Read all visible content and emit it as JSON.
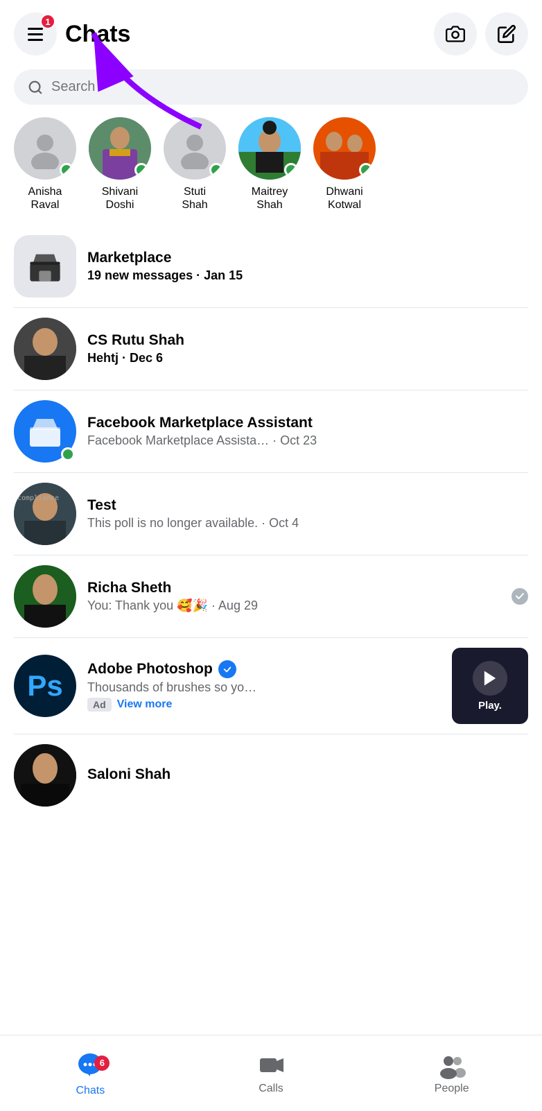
{
  "header": {
    "title": "Chats",
    "badge": "1",
    "camera_label": "camera",
    "compose_label": "compose"
  },
  "search": {
    "placeholder": "Search"
  },
  "stories": [
    {
      "id": "anisha",
      "name": "Anisha\nRaval",
      "online": true,
      "has_photo": false
    },
    {
      "id": "shivani",
      "name": "Shivani\nDoshi",
      "online": true,
      "has_photo": true
    },
    {
      "id": "stuti",
      "name": "Stuti\nShah",
      "online": true,
      "has_photo": false
    },
    {
      "id": "maitrey",
      "name": "Maitrey\nShah",
      "online": true,
      "has_photo": true
    },
    {
      "id": "dhwani",
      "name": "Dhwani\nKotwal",
      "online": true,
      "has_photo": true
    }
  ],
  "chats": [
    {
      "id": "marketplace",
      "name": "Marketplace",
      "preview": "19 new messages",
      "date": "Jan 15",
      "type": "marketplace",
      "bold": true
    },
    {
      "id": "cs-rutu-shah",
      "name": "CS Rutu Shah",
      "preview": "Hehtj",
      "date": "Dec 6",
      "type": "person",
      "bold": true
    },
    {
      "id": "fb-marketplace-assistant",
      "name": "Facebook Marketplace Assistant",
      "preview": "Facebook Marketplace Assista…",
      "date": "Oct 23",
      "type": "fb-marketplace",
      "online": true,
      "bold": false
    },
    {
      "id": "test",
      "name": "Test",
      "preview": "This poll is no longer available.",
      "date": "Oct 4",
      "type": "person",
      "bold": false
    },
    {
      "id": "richa-sheth",
      "name": "Richa Sheth",
      "preview": "You: Thank you 🥰🎉",
      "date": "Aug 29",
      "type": "person",
      "bold": false,
      "read": true
    },
    {
      "id": "adobe-photoshop",
      "name": "Adobe Photoshop",
      "preview": "Thousands of brushes so yo…",
      "date": "",
      "type": "ad",
      "verified": true,
      "bold": false,
      "ad_label": "Ad",
      "view_more": "View more"
    },
    {
      "id": "saloni-shah",
      "name": "Saloni Shah",
      "preview": "",
      "date": "",
      "type": "person",
      "bold": false
    }
  ],
  "bottom_nav": {
    "items": [
      {
        "id": "chats",
        "label": "Chats",
        "active": true,
        "badge": "6"
      },
      {
        "id": "calls",
        "label": "Calls",
        "active": false,
        "badge": ""
      },
      {
        "id": "people",
        "label": "People",
        "active": false,
        "badge": ""
      }
    ]
  }
}
